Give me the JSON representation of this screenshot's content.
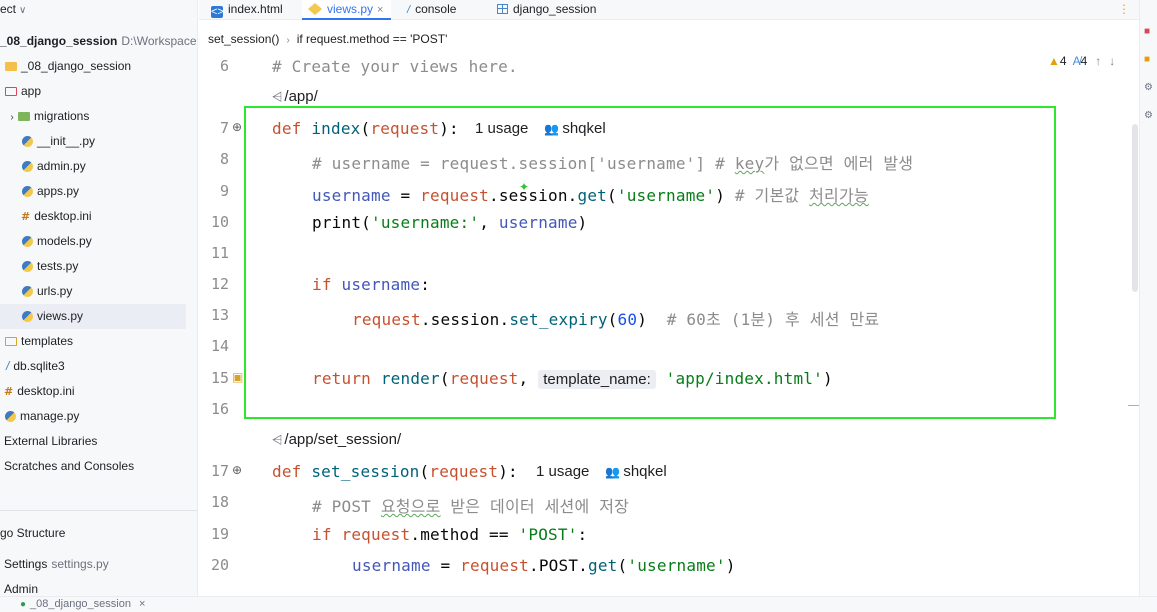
{
  "project_panel": {
    "header": "ect",
    "items": [
      {
        "label": "_08_django_session",
        "hint": "D:\\Workspace"
      },
      {
        "label": "_08_django_session"
      },
      {
        "label": "app"
      },
      {
        "label": "migrations"
      },
      {
        "label": "__init__.py"
      },
      {
        "label": "admin.py"
      },
      {
        "label": "apps.py"
      },
      {
        "label": "desktop.ini"
      },
      {
        "label": "models.py"
      },
      {
        "label": "tests.py"
      },
      {
        "label": "urls.py"
      },
      {
        "label": "views.py"
      },
      {
        "label": "templates"
      },
      {
        "label": "db.sqlite3"
      },
      {
        "label": "desktop.ini"
      },
      {
        "label": "manage.py"
      },
      {
        "label": "External Libraries"
      },
      {
        "label": "Scratches and Consoles"
      }
    ],
    "structure_title": "go Structure",
    "structure_items": [
      {
        "label": "Settings",
        "hint": "settings.py"
      },
      {
        "label": "Admin"
      }
    ]
  },
  "tabs": [
    {
      "label": "index.html",
      "icon": "html-file-icon"
    },
    {
      "label": "views.py",
      "icon": "python-file-icon",
      "close": "×"
    },
    {
      "label": "console",
      "icon": "console-icon"
    },
    {
      "label": "django_session",
      "icon": "table-icon"
    }
  ],
  "breadcrumb": {
    "items": [
      "set_session()",
      "if request.method == 'POST'"
    ]
  },
  "inspections": {
    "warnings": "4",
    "typos": "4"
  },
  "editor": {
    "line_numbers": [
      "6",
      "7",
      "8",
      "9",
      "10",
      "11",
      "12",
      "13",
      "14",
      "15",
      "16",
      "17",
      "18",
      "19",
      "20"
    ],
    "comment_create": "# Create your views here.",
    "route_app": "/app/",
    "route_set_session": "/app/set_session/",
    "usage_index": "1 usage",
    "author_index": "shqkel",
    "usage_set_session": "1 usage",
    "author_set_session": "shqkel",
    "kw_def": "def",
    "fn_index": "index",
    "fn_set_session": "set_session",
    "param_request": "request",
    "l8_comment": "# username = request.session['username'] # ",
    "l8_comment_key": "key",
    "l8_comment_rest": "가 없으면 에러 발생",
    "l9_var": "username",
    "l9_eq": " = ",
    "l9_req": "request",
    "l9_mid": ".session.",
    "l9_get": "get",
    "l9_str": "'username'",
    "l9_comment": "# 기본값 ",
    "l9_comment_sq": "처리가능",
    "l10_print": "print",
    "l10_str": "'username:'",
    "l10_var": "username",
    "kw_if": "if",
    "l12_var": "username",
    "l13_req": "request",
    "l13_mid": ".session.",
    "l13_meth": "set_expiry",
    "l13_num": "60",
    "l13_comment": "# 60초 (1분) 후 세션 만료",
    "kw_return": "return",
    "l15_render": "render",
    "l15_req": "request",
    "l15_inlay": "template_name:",
    "l15_str": "'app/index.html'",
    "l18_comment_a": "# POST ",
    "l18_comment_sq": "요청으로",
    "l18_comment_b": " 받은 데이터 세션에 저장",
    "l19_req": "request",
    "l19_mid": ".method == ",
    "l19_str": "'POST'",
    "l20_var": "username",
    "l20_eq": " = ",
    "l20_req": "request",
    "l20_mid": ".POST.",
    "l20_get": "get",
    "l20_str": "'username'"
  },
  "bottom_bar": {
    "label": "_08_django_session"
  },
  "colors": {
    "highlight_box": "#2ee62e",
    "keyword": "#c7512f",
    "string": "#067d17",
    "accent": "#3574f0"
  }
}
